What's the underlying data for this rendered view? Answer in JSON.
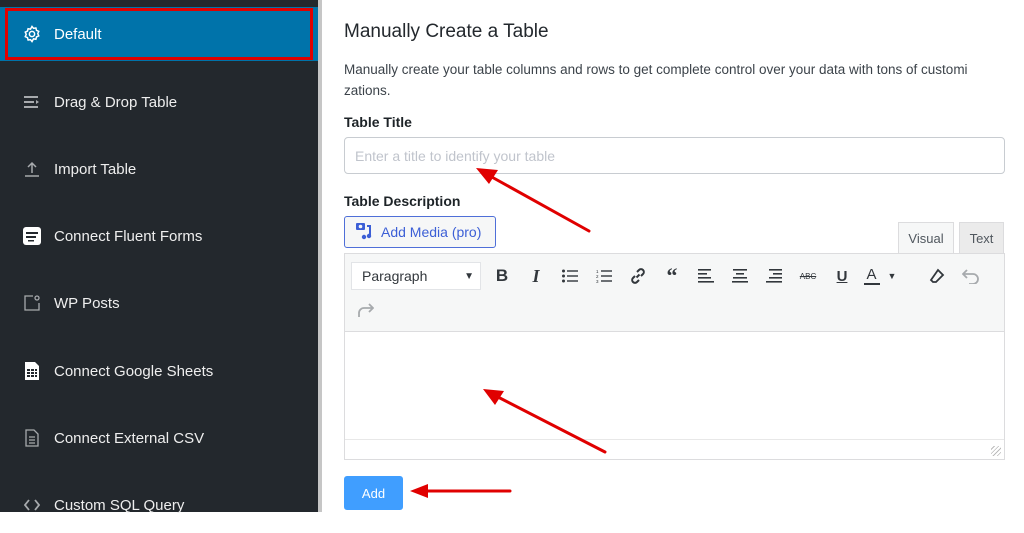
{
  "sidebar": {
    "items": [
      {
        "label": "Default",
        "icon": "gear-icon",
        "active": true
      },
      {
        "label": "Drag & Drop Table",
        "icon": "drag-drop-icon"
      },
      {
        "label": "Import Table",
        "icon": "upload-icon"
      },
      {
        "label": "Connect Fluent Forms",
        "icon": "fluent-forms-icon"
      },
      {
        "label": "WP Posts",
        "icon": "posts-icon"
      },
      {
        "label": "Connect Google Sheets",
        "icon": "spreadsheet-icon"
      },
      {
        "label": "Connect External CSV",
        "icon": "document-icon"
      },
      {
        "label": "Custom SQL Query",
        "icon": "code-icon"
      }
    ]
  },
  "main": {
    "title": "Manually Create a Table",
    "description": "Manually create your table columns and rows to get complete control over your data with tons of customi zations.",
    "table_title": {
      "label": "Table Title",
      "value": "",
      "placeholder": "Enter a title to identify your table"
    },
    "table_description": {
      "label": "Table Description",
      "add_media_label": "Add Media (pro)",
      "tabs": [
        "Visual",
        "Text"
      ],
      "active_tab": "Visual",
      "format_select": "Paragraph",
      "toolbar": [
        "bold",
        "italic",
        "bulleted-list",
        "numbered-list",
        "link",
        "blockquote",
        "align-left",
        "align-center",
        "align-right",
        "strikethrough",
        "underline",
        "text-color",
        "clear-formatting",
        "undo",
        "redo"
      ]
    },
    "add_button_label": "Add"
  },
  "annotations": {
    "highlight_color": "#e00000",
    "arrow_color": "#e00000"
  }
}
